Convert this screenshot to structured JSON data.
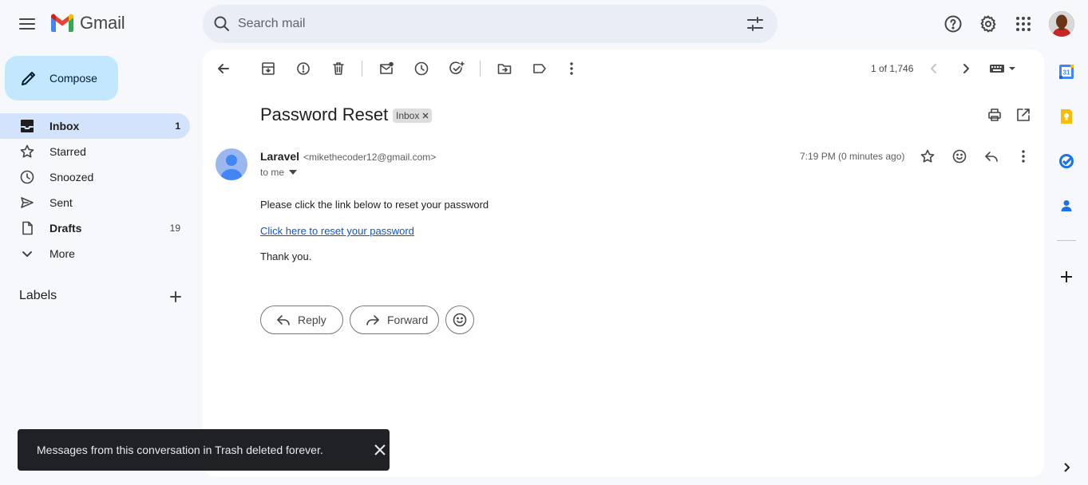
{
  "header": {
    "app_name": "Gmail",
    "search_placeholder": "Search mail"
  },
  "sidebar": {
    "compose_label": "Compose",
    "items": [
      {
        "label": "Inbox",
        "count": "1",
        "icon": "inbox-icon",
        "active": true
      },
      {
        "label": "Starred",
        "count": "",
        "icon": "star-icon"
      },
      {
        "label": "Snoozed",
        "count": "",
        "icon": "clock-icon"
      },
      {
        "label": "Sent",
        "count": "",
        "icon": "send-icon"
      },
      {
        "label": "Drafts",
        "count": "19",
        "icon": "draft-icon"
      },
      {
        "label": "More",
        "count": "",
        "icon": "chevron-down-icon"
      }
    ],
    "labels_title": "Labels"
  },
  "toolbar": {
    "page_count": "1 of 1,746"
  },
  "email": {
    "subject": "Password Reset",
    "label_chip": "Inbox",
    "sender_name": "Laravel",
    "sender_email": "<mikethecoder12@gmail.com>",
    "to_line": "to me",
    "timestamp": "7:19 PM (0 minutes ago)",
    "body_line1": "Please click the link below to reset your password",
    "body_link": "Click here to reset your password",
    "body_line3": "Thank you.",
    "reply_label": "Reply",
    "forward_label": "Forward"
  },
  "snackbar": {
    "message": "Messages from this conversation in Trash deleted forever."
  },
  "colors": {
    "accent": "#0b57d0",
    "compose_bg": "#c2e7ff",
    "active_nav_bg": "#d3e3fd",
    "link": "#1155cc"
  }
}
